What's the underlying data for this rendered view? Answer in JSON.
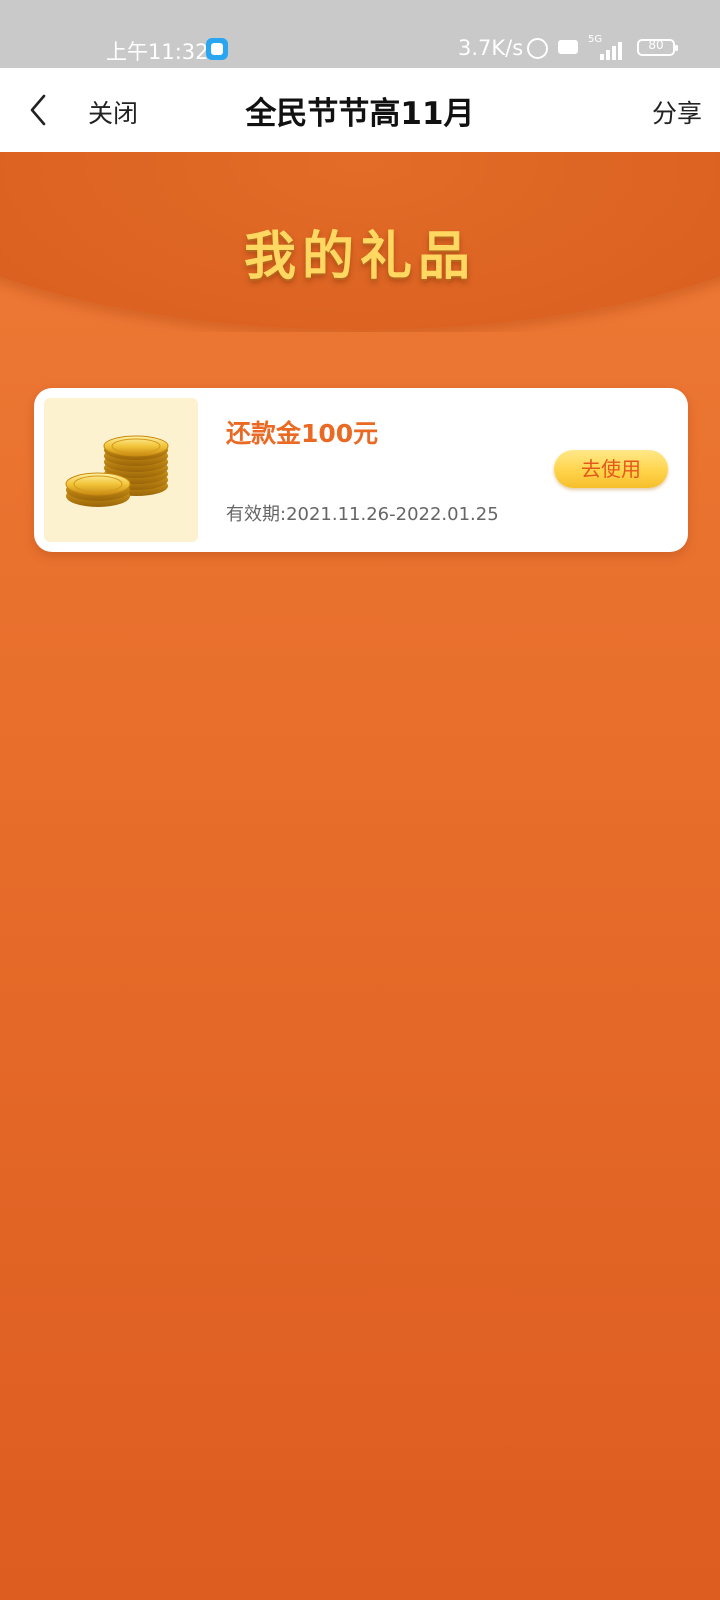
{
  "status_bar": {
    "time": "上午11:32",
    "net_speed": "3.7K/s",
    "network": "5G",
    "battery": "80",
    "icons": [
      "app-notification-icon",
      "alarm-icon",
      "hd-icon",
      "signal-icon",
      "battery-icon"
    ]
  },
  "nav": {
    "close_label": "关闭",
    "title": "全民节节高11月",
    "share_label": "分享"
  },
  "banner": {
    "title": "我的礼品"
  },
  "gifts": [
    {
      "title": "还款金100元",
      "validity": "有效期:2021.11.26-2022.01.25",
      "action_label": "去使用",
      "icon": "gold-coins-icon"
    }
  ],
  "colors": {
    "background_top": "#ee7b38",
    "background_bottom": "#dd5c20",
    "banner_title": "#ffd862",
    "gift_title": "#ea6a24",
    "button_text": "#e5581c",
    "button_fill": "#ffd44a"
  }
}
